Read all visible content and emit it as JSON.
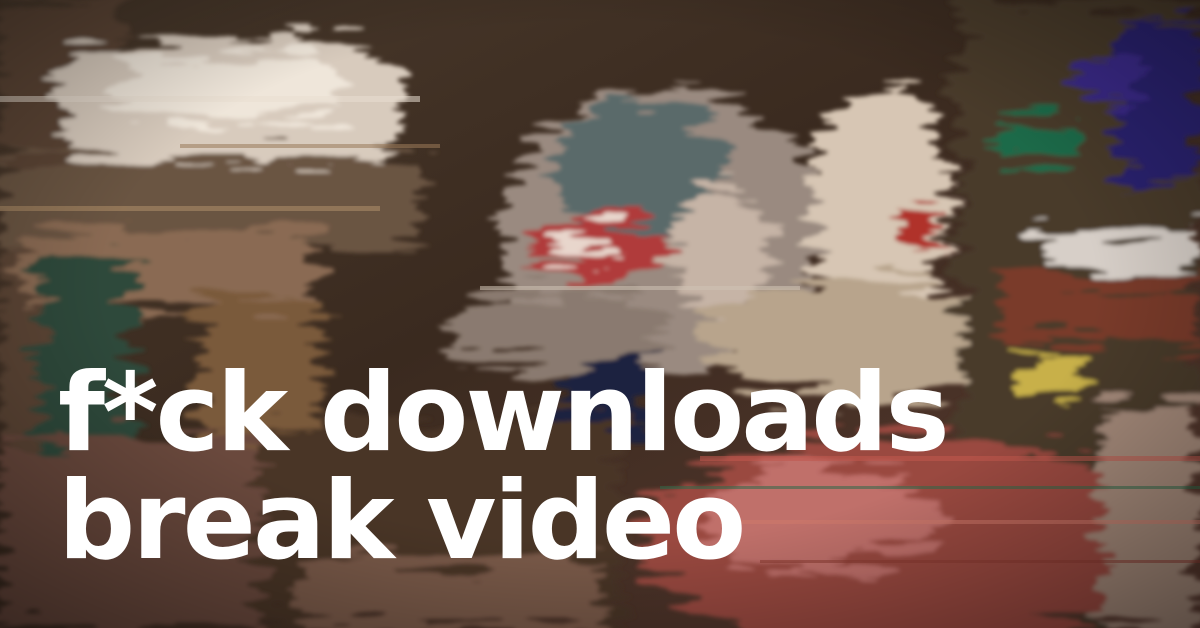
{
  "headline": {
    "line1": "f*ck downloads",
    "line2": "break video"
  },
  "background": {
    "description_colors": [
      "#3b2a20",
      "#6a4a3a",
      "#c9b7a8",
      "#2b1f66",
      "#a03a34",
      "#1f5a3a"
    ],
    "icon": "glitch-art-image"
  }
}
